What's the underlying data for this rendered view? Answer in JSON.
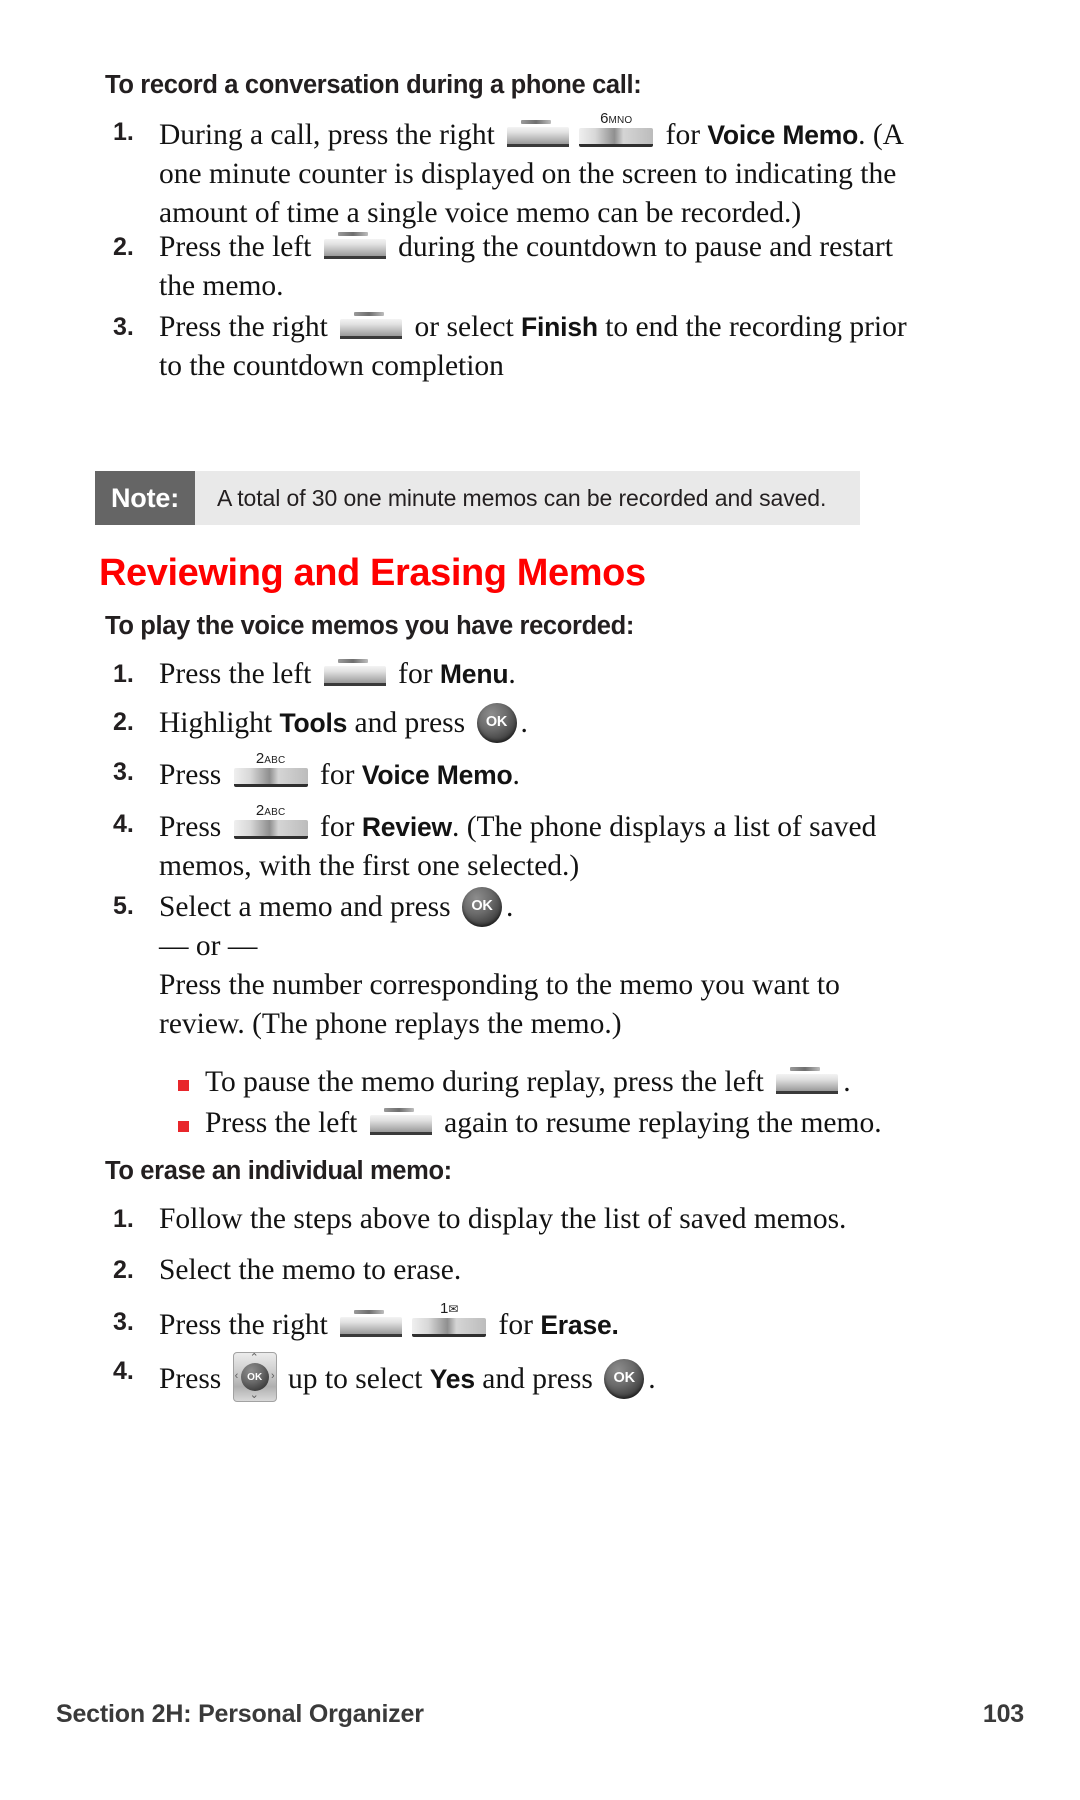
{
  "page": {
    "number": "103",
    "footer_section": "Section 2H: Personal Organizer"
  },
  "sections": [
    {
      "heading": "To record a conversation during a phone call:",
      "steps": [
        {
          "num": "1.",
          "parts": [
            {
              "type": "text",
              "value": "During a call, press the right "
            },
            {
              "type": "icon",
              "icon": "softkey-blank"
            },
            {
              "type": "icon",
              "icon": "numkey-6-mno",
              "label_main": "6",
              "label_sub": "MNO"
            },
            {
              "type": "text",
              "value": " for "
            },
            {
              "type": "bold",
              "value": "Voice Memo"
            },
            {
              "type": "text",
              "value": ". (A"
            }
          ],
          "continuation": [
            "one minute counter is displayed on the screen to indicating the",
            "amount of time a single voice memo can be recorded.)"
          ]
        },
        {
          "num": "2.",
          "parts": [
            {
              "type": "text",
              "value": "Press the left "
            },
            {
              "type": "icon",
              "icon": "softkey-blank"
            },
            {
              "type": "text",
              "value": " during the countdown to pause and restart"
            }
          ],
          "continuation": [
            "the memo."
          ]
        },
        {
          "num": "3.",
          "parts": [
            {
              "type": "text",
              "value": "Press the right "
            },
            {
              "type": "icon",
              "icon": "softkey-blank"
            },
            {
              "type": "text",
              "value": " or select "
            },
            {
              "type": "bold",
              "value": "Finish"
            },
            {
              "type": "text",
              "value": " to end the recording prior"
            }
          ],
          "continuation": [
            "to the countdown completion"
          ]
        }
      ]
    }
  ],
  "note": {
    "tag": "Note:",
    "text": "A total of 30  one minute memos can be recorded and saved."
  },
  "red_heading": "Reviewing and Erasing Memos",
  "play_section": {
    "heading": "To play the voice memos you have recorded:",
    "steps": [
      {
        "num": "1.",
        "text_before": "Press the left ",
        "icon": "softkey-blank",
        "text_mid": " for ",
        "bold": "Menu",
        "text_after": "."
      },
      {
        "num": "2.",
        "text_before": "Highlight ",
        "bold_first": "Tools",
        "text_mid": " and press ",
        "icon": "ok-key",
        "text_after": "."
      },
      {
        "num": "3.",
        "text_before": "Press ",
        "icon": "numkey-2-abc",
        "label_main": "2",
        "label_sub": "ABC",
        "text_mid": " for ",
        "bold": "Voice Memo",
        "text_after": "."
      },
      {
        "num": "4.",
        "text_before": "Press ",
        "icon": "numkey-2-abc",
        "label_main": "2",
        "label_sub": "ABC",
        "text_mid": " for ",
        "bold": "Review",
        "text_after": ". (The phone displays a list of saved",
        "continuation": "memos, with the first one selected.)"
      },
      {
        "num": "5.",
        "text_before": "Select a memo and press ",
        "icon": "ok-key",
        "text_after": ".",
        "or_label": "— or —",
        "continuation_lines": [
          "Press the number corresponding to the memo you want to",
          "review. (The phone replays the memo.)"
        ]
      }
    ],
    "bullets": [
      {
        "text_before": "To pause the memo during replay, press the left ",
        "icon": "softkey-blank",
        "text_after": "."
      },
      {
        "text_before": "Press the left ",
        "icon": "softkey-blank",
        "text_after": " again to resume replaying the memo."
      }
    ]
  },
  "erase_section": {
    "heading": "To erase an individual memo:",
    "steps": [
      {
        "num": "1.",
        "text": "Follow the steps above to display the list of saved memos."
      },
      {
        "num": "2.",
        "text": "Select the memo to erase."
      },
      {
        "num": "3.",
        "text_before": "Press the right ",
        "icon1": "softkey-blank",
        "icon2": "numkey-1-envelope",
        "label_main": "1",
        "label_sub": "✉",
        "text_mid": " for ",
        "bold": "Erase.",
        "text_after": ""
      },
      {
        "num": "4.",
        "text_before": "Press ",
        "icon1": "navigation-key",
        "text_mid": " up to select ",
        "bold": "Yes",
        "text_mid2": " and press ",
        "icon2": "ok-key",
        "text_after": "."
      }
    ]
  },
  "colors": {
    "heading_red": "#ff0000",
    "bullet_red": "#e8262b",
    "note_tag_bg": "#656565",
    "note_body_bg": "#e9e9e9",
    "body_text": "#131313"
  },
  "icon_labels": {
    "ok": "OK",
    "key6_main": "6",
    "key6_sub": "MNO",
    "key2_main": "2",
    "key2_sub": "ABC",
    "key1_main": "1",
    "key1_sub": "✉",
    "nav_up": "⌃",
    "nav_down": "⌄",
    "nav_left": "‹",
    "nav_right": "›"
  }
}
